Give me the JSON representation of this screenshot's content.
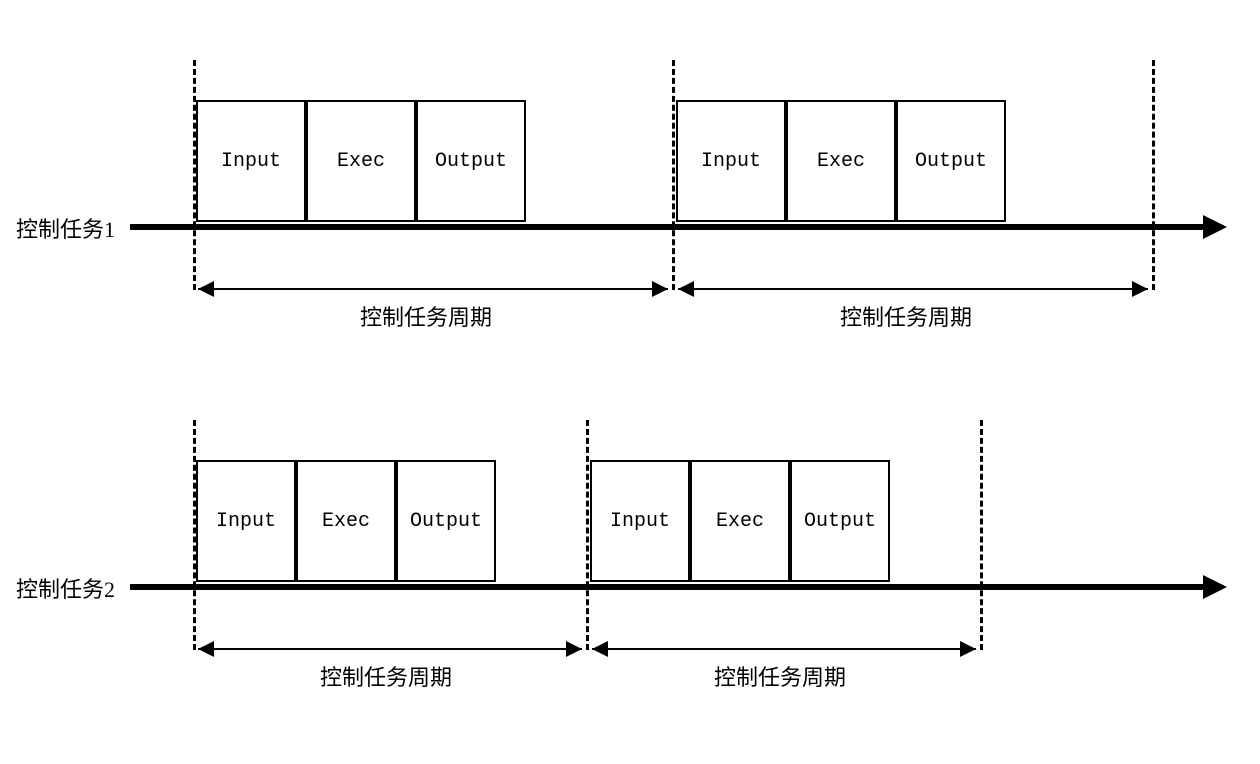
{
  "task1": {
    "label": "控制任务1",
    "phases": [
      "Input",
      "Exec",
      "Output"
    ],
    "period_label": "控制任务周期"
  },
  "task2": {
    "label": "控制任务2",
    "phases": [
      "Input",
      "Exec",
      "Output"
    ],
    "period_label": "控制任务周期"
  }
}
